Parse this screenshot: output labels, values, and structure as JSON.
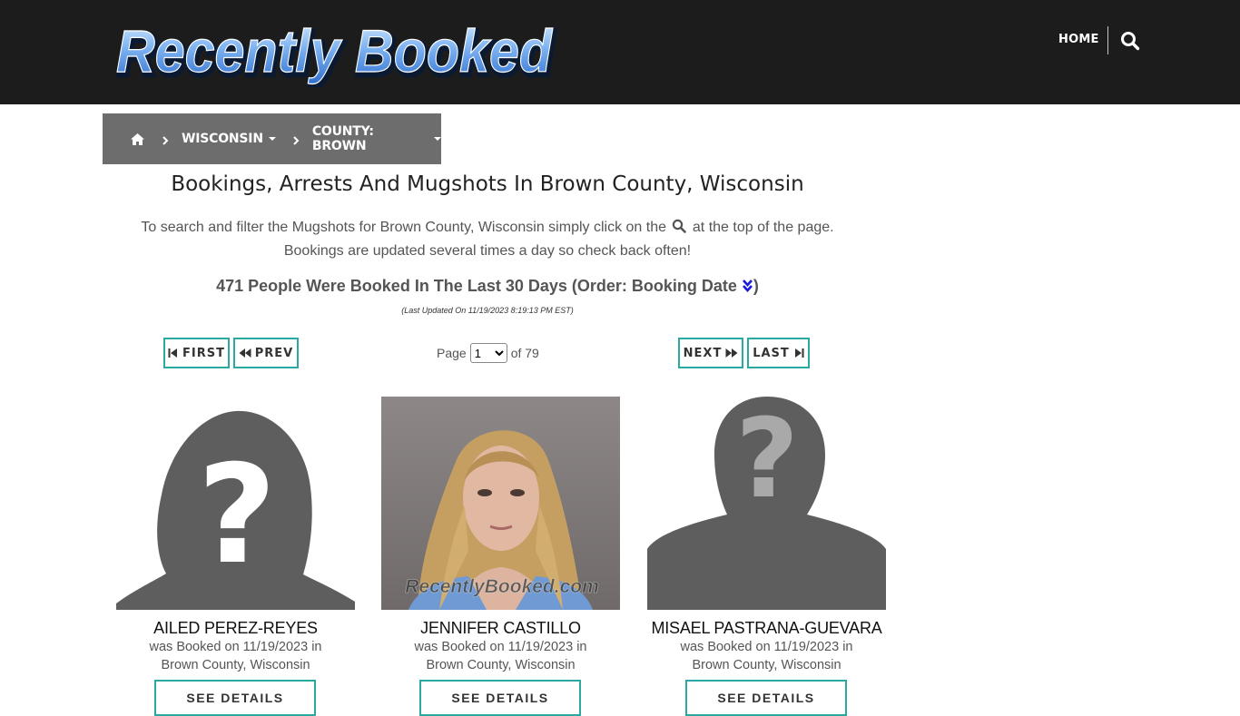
{
  "header": {
    "logo_text": "Recently Booked",
    "nav_home": "HOME",
    "search_icon": "search-icon"
  },
  "breadcrumb": {
    "home_icon": "home-icon",
    "state": "WISCONSIN",
    "county": "COUNTY: BROWN"
  },
  "main": {
    "title": "Bookings, Arrests And Mugshots In Brown County, Wisconsin",
    "intro_part1": "To search and filter the Mugshots for Brown County, Wisconsin simply click on the",
    "intro_part2": "at the top of the page.",
    "intro_line2": "Bookings are updated several times a day so check back often!",
    "count_text": "471 People Were Booked In The Last 30 Days (Order: Booking Date",
    "count_close": ")",
    "last_updated": "(Last Updated On 11/19/2023 8:19:13 PM EST)"
  },
  "pagination": {
    "first": "FIRST",
    "prev": "PREV",
    "page_label": "Page",
    "current_page": "1",
    "of_label": "of 79",
    "next": "NEXT",
    "last": "LAST"
  },
  "bookings": [
    {
      "name": "AILED PEREZ-REYES",
      "line1": "was Booked on 11/19/2023 in",
      "line2": "Brown County, Wisconsin",
      "button": "SEE DETAILS",
      "image": "female-silhouette-placeholder"
    },
    {
      "name": "JENNIFER CASTILLO",
      "line1": "was Booked on 11/19/2023 in",
      "line2": "Brown County, Wisconsin",
      "button": "SEE DETAILS",
      "image": "mugshot-photo",
      "watermark": "RecentlyBooked.com"
    },
    {
      "name": "MISAEL PASTRANA-GUEVARA",
      "line1": "was Booked on 11/19/2023 in",
      "line2": "Brown County, Wisconsin",
      "button": "SEE DETAILS",
      "image": "male-silhouette-placeholder"
    }
  ],
  "colors": {
    "header_bg": "#1c1c1c",
    "breadcrumb_bg": "#6d6d6d",
    "button_border": "#2aa8a2",
    "logo_blue": "#5b9bea",
    "order_icon": "#1a1adb"
  }
}
